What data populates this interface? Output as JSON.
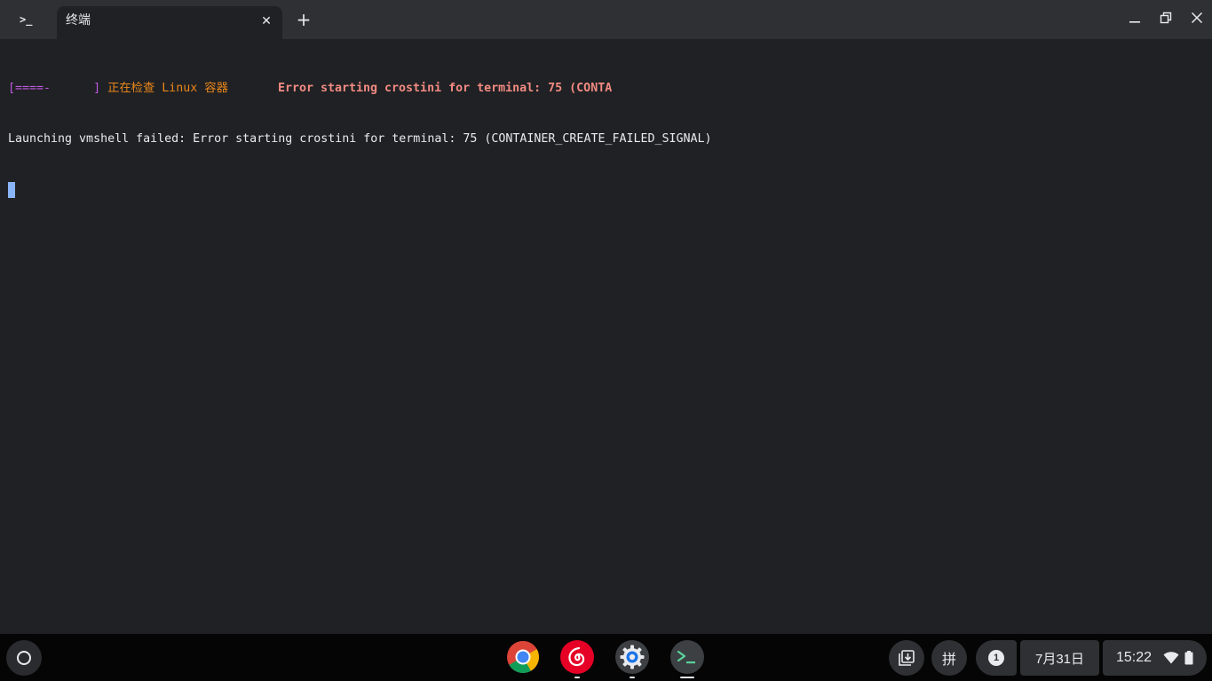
{
  "window": {
    "app_icon_glyph": ">_",
    "tab_title": "终端",
    "tab_close_glyph": "✕",
    "new_tab_glyph": "+"
  },
  "terminal": {
    "line1": {
      "progress": "[====-      ]",
      "status": " 正在检查 Linux 容器",
      "gap": "       ",
      "error": "Error starting crostini for terminal: 75 (CONTA"
    },
    "line2": "Launching vmshell failed: Error starting crostini for terminal: 75 (CONTAINER_CREATE_FAILED_SIGNAL)"
  },
  "shelf": {
    "apps": [
      {
        "name": "chrome-app",
        "icon": "chrome-icon",
        "running": false
      },
      {
        "name": "netease-music-app",
        "icon": "netease-cloud-music-icon",
        "running": true
      },
      {
        "name": "settings-app",
        "icon": "gear-icon",
        "running": true
      },
      {
        "name": "terminal-app",
        "icon": "terminal-icon",
        "running": true,
        "active": true
      }
    ],
    "tray": {
      "ime_label": "拼",
      "notification_count": "1",
      "date": "7月31日",
      "time": "15:22"
    }
  },
  "colors": {
    "titlebar": "#2f3033",
    "terminal_bg": "#202124",
    "progress": "#c058e0",
    "status": "#e8861a",
    "error": "#f28b82",
    "cursor": "#8ab4f8",
    "shelf_bg": "#050506"
  }
}
